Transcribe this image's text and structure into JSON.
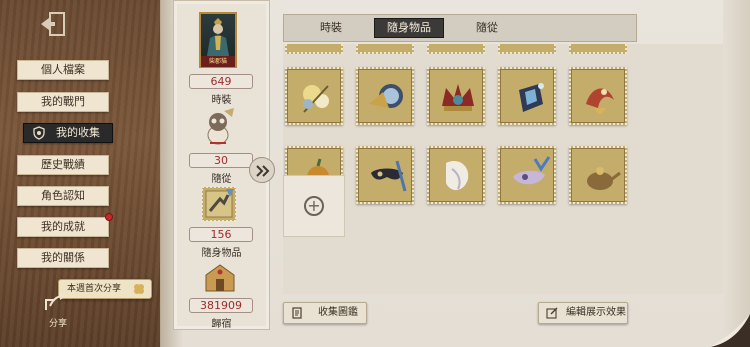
{
  "nav": {
    "exit_icon": "exit-door-icon",
    "items": [
      {
        "label": "個人檔案"
      },
      {
        "label": "我的戰門"
      },
      {
        "label": "我的收集",
        "icon": "shield-badge-icon"
      },
      {
        "label": "歷史戰績"
      },
      {
        "label": "角色認知"
      },
      {
        "label": "我的成就",
        "badge_color": "#c9282b"
      },
      {
        "label": "我的關係"
      }
    ],
    "share_tag": "本週首次分享",
    "share_label": "分享"
  },
  "stats": {
    "portrait_name": "柴郡貓",
    "items": [
      {
        "value": "649",
        "label": "時裝"
      },
      {
        "value": "30",
        "label": "隨從"
      },
      {
        "value": "156",
        "label": "隨身物品"
      },
      {
        "value": "381909",
        "label": "歸宿"
      }
    ]
  },
  "tabs": [
    {
      "label": "時裝"
    },
    {
      "label": "隨身物品",
      "active": true
    },
    {
      "label": "隨從"
    }
  ],
  "grid": {
    "item_count": 10,
    "add_slot_icon": "plus-icon"
  },
  "buttons": {
    "collection": "收集圖鑑",
    "edit_display": "編輯展示效果"
  },
  "colors": {
    "accent_red": "#9c2d2b",
    "stamp_gold": "#c4ad6b",
    "active_tab": "#3c3a38"
  }
}
